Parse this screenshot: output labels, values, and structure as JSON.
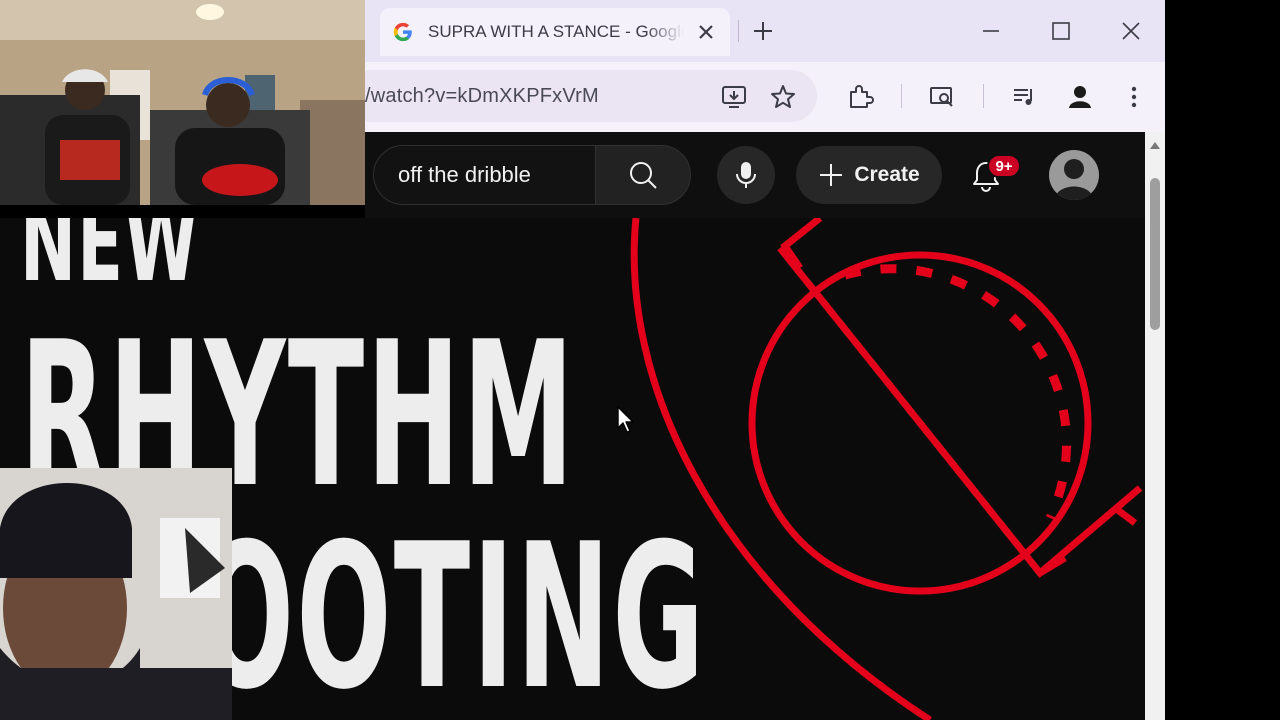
{
  "browser": {
    "tab": {
      "title": "SUPRA WITH A STANCE - Google Chrome",
      "favicon": "google-favicon-icon"
    },
    "omnibox": {
      "url": "/watch?v=kDmXKPFxVrM"
    },
    "colors": {
      "tabstrip": "#e9e3f6",
      "toolbar": "#f5f1fb"
    }
  },
  "youtube": {
    "search": {
      "query": "off the dribble"
    },
    "create_label": "Create",
    "notification_count": "9+",
    "colors": {
      "badge": "#cc0022",
      "background": "#0f0f0f"
    }
  },
  "video": {
    "thumbnail_lines": [
      "NEW",
      "RHYTHM",
      "SHOOTING"
    ],
    "accent_color": "#e4001b"
  }
}
